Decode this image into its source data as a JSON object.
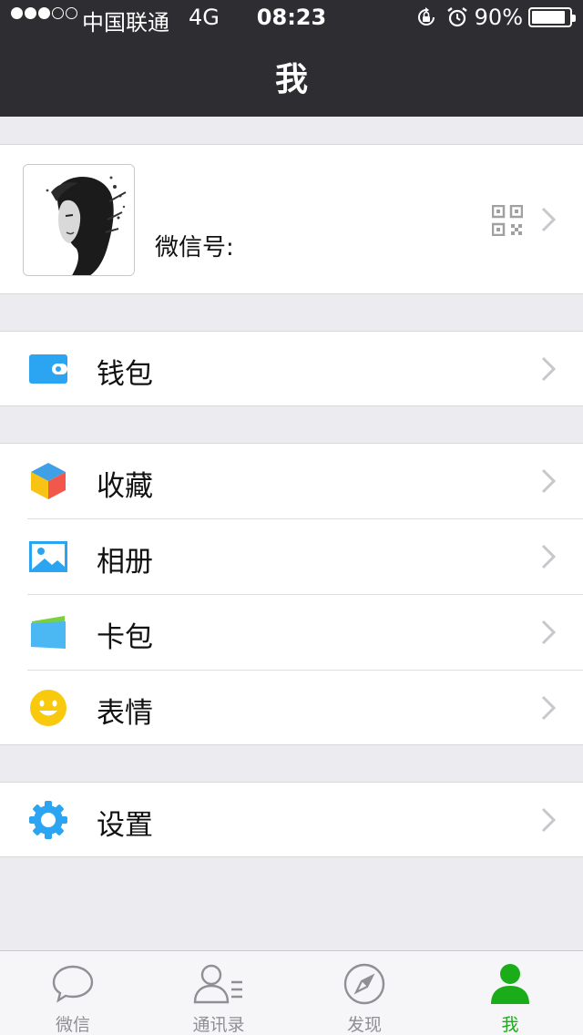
{
  "status_bar": {
    "carrier": "中国联通",
    "network": "4G",
    "time": "08:23",
    "battery": "90%",
    "battery_level": 0.9,
    "signal_bars_filled": 3,
    "signal_bars_total": 5,
    "icons": [
      "orientation-lock-icon",
      "alarm-icon",
      "battery-icon"
    ]
  },
  "header": {
    "title": "我"
  },
  "profile": {
    "wechat_id_label": "微信号:",
    "icons": [
      "avatar",
      "qr-code-icon",
      "chevron-right-icon"
    ]
  },
  "menu": {
    "wallet": {
      "label": "钱包",
      "icon": "wallet-icon"
    },
    "favorites": {
      "label": "收藏",
      "icon": "favorites-cube-icon"
    },
    "album": {
      "label": "相册",
      "icon": "album-icon"
    },
    "cards": {
      "label": "卡包",
      "icon": "card-wallet-icon"
    },
    "stickers": {
      "label": "表情",
      "icon": "smiley-icon"
    },
    "settings": {
      "label": "设置",
      "icon": "gear-icon"
    }
  },
  "tabbar": {
    "tabs": [
      {
        "label": "微信",
        "icon": "chat-bubble-icon",
        "active": false
      },
      {
        "label": "通讯录",
        "icon": "contacts-icon",
        "active": false
      },
      {
        "label": "发现",
        "icon": "compass-icon",
        "active": false
      },
      {
        "label": "我",
        "icon": "person-icon",
        "active": true
      }
    ]
  },
  "colors": {
    "accent": "#1aad19",
    "header_bg": "#2e2e32",
    "icon_blue": "#2ba5f1",
    "page_bg": "#ececf0"
  }
}
